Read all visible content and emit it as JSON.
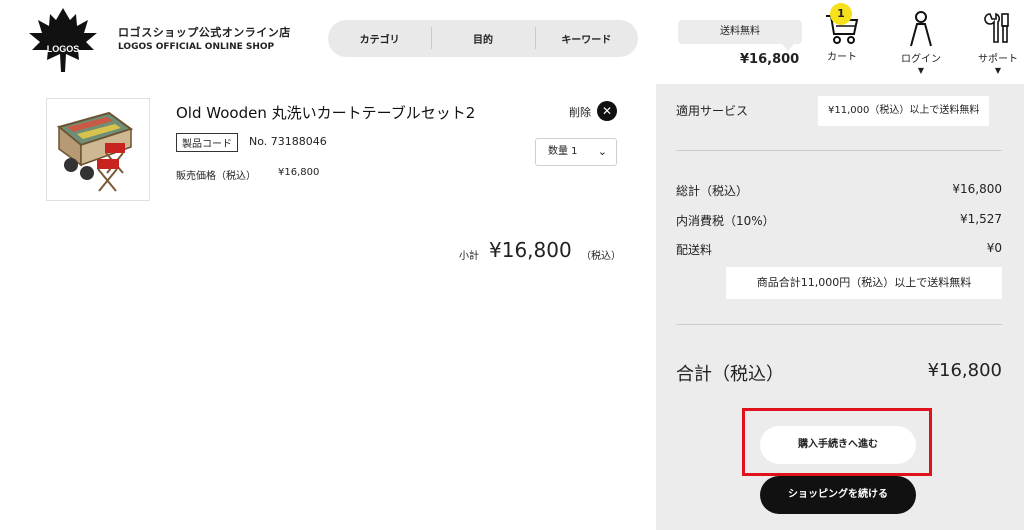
{
  "header": {
    "logo_text": "LOGOS",
    "shop_name_ja": "ロゴスショップ公式オンライン店",
    "shop_name_en": "LOGOS OFFICIAL ONLINE SHOP",
    "nav": [
      "カテゴリ",
      "目的",
      "キーワード"
    ],
    "shipping_badge": "送料無料",
    "cart_total": "¥16,800",
    "cart_count": "1",
    "cart_label": "カート",
    "login_label": "ログイン",
    "support_label": "サポート",
    "caret": "▼"
  },
  "icons": {
    "cart": "cart-icon",
    "login": "person-icon",
    "support": "tools-icon",
    "delete": "close-icon",
    "qty": "chevron-down-icon"
  },
  "product": {
    "name": "Old Wooden 丸洗いカートテーブルセット2",
    "delete_label": "削除",
    "delete_glyph": "✕",
    "code_tag": "製品コード",
    "code_no": "No. 73188046",
    "qty_label": "数量 1",
    "qty_chevron": "⌄",
    "price_label": "販売価格（税込）",
    "price_value": "¥16,800",
    "subtotal_label": "小計",
    "subtotal_value": "¥16,800",
    "subtotal_tax": "（税込）"
  },
  "summary": {
    "service_label": "適用サービス",
    "service_note": "¥11,000（税込）以上で送料無料",
    "total_label": "総計（税込）",
    "total_value": "¥16,800",
    "tax_label": "内消費税（10%）",
    "tax_value": "¥1,527",
    "shipping_label": "配送料",
    "shipping_value": "¥0",
    "shipping_note": "商品合計11,000円（税込）以上で送料無料",
    "grand_label": "合計（税込）",
    "grand_value": "¥16,800",
    "checkout_button": "購入手続きへ進む",
    "continue_button": "ショッピングを続ける"
  },
  "colors": {
    "accent_highlight": "#e0121b",
    "badge_yellow": "#f7e11a",
    "panel_bg": "#ececec"
  }
}
